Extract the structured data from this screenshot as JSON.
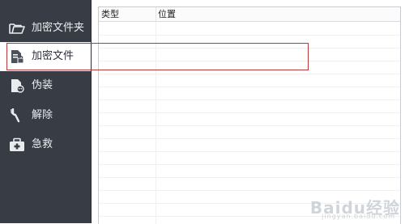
{
  "sidebar": {
    "items": [
      {
        "label": "加密文件夹",
        "icon": "folder-icon"
      },
      {
        "label": "加密文件",
        "icon": "encrypted-file-icon"
      },
      {
        "label": "伪装",
        "icon": "disguise-icon"
      },
      {
        "label": "解除",
        "icon": "wrench-icon"
      },
      {
        "label": "急救",
        "icon": "first-aid-kit-icon"
      }
    ],
    "active_index": 1
  },
  "table": {
    "columns": [
      "类型",
      "位置"
    ],
    "rows": []
  },
  "watermark": {
    "text": "Baidu经验",
    "sub": "jingyan.baidu.com"
  },
  "colors": {
    "sidebar_bg": "#383c44",
    "highlight_border": "#b53a3a"
  }
}
